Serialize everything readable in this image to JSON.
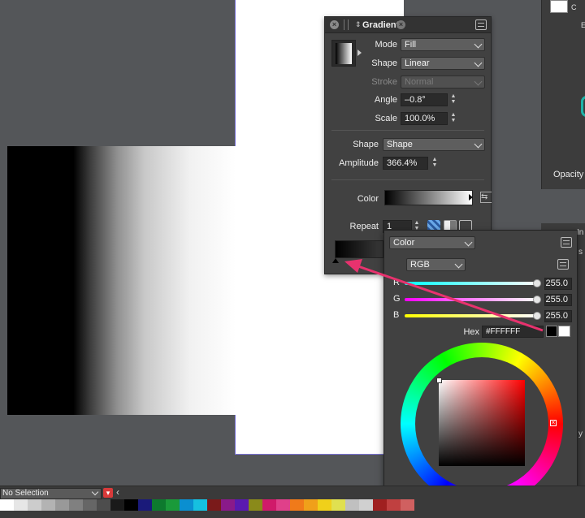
{
  "gradient_panel": {
    "title": "Gradient",
    "mode_label": "Mode",
    "mode_value": "Fill",
    "shape_label": "Shape",
    "shape_value": "Linear",
    "stroke_label": "Stroke",
    "stroke_value": "Normal",
    "angle_label": "Angle",
    "angle_value": "–0.8°",
    "scale_label": "Scale",
    "scale_value": "100.0%",
    "shape2_label": "Shape",
    "shape2_value": "Shape",
    "amplitude_label": "Amplitude",
    "amplitude_value": "366.4%",
    "color_label": "Color",
    "repeat_label": "Repeat",
    "repeat_value": "1"
  },
  "color_popup": {
    "type_value": "Color",
    "model_value": "RGB",
    "r_label": "R",
    "r_value": "255.0",
    "g_label": "G",
    "g_value": "255.0",
    "b_label": "B",
    "b_value": "255.0",
    "hex_label": "Hex",
    "hex_value": "#FFFFFF"
  },
  "right_panel": {
    "opacity_label": "Opacity",
    "snip_c": "C",
    "snip_e": "E",
    "snip_in": "In",
    "snip_s": "s",
    "snip_y": "y"
  },
  "bottom_bar": {
    "selection_value": "No Selection"
  },
  "colors": {
    "annotation_arrow": "#e8326e",
    "palette": [
      "#ffffff",
      "#e6e6e6",
      "#cccccc",
      "#b3b3b3",
      "#999999",
      "#808080",
      "#666666",
      "#4d4d4d",
      "#1a1a1a",
      "#000000",
      "#1a1a7a",
      "#0d7a2e",
      "#1a9a3a",
      "#0a8fd0",
      "#16c0e0",
      "#7a1a1a",
      "#8a1a8a",
      "#5a1ab0",
      "#8a8a1a",
      "#d01a6a",
      "#e0408a",
      "#f07a1a",
      "#f0a01a",
      "#f0d01a",
      "#e0e050",
      "#c0c0c0",
      "#d0d0d0",
      "#a02020",
      "#c04040",
      "#d06060"
    ]
  }
}
